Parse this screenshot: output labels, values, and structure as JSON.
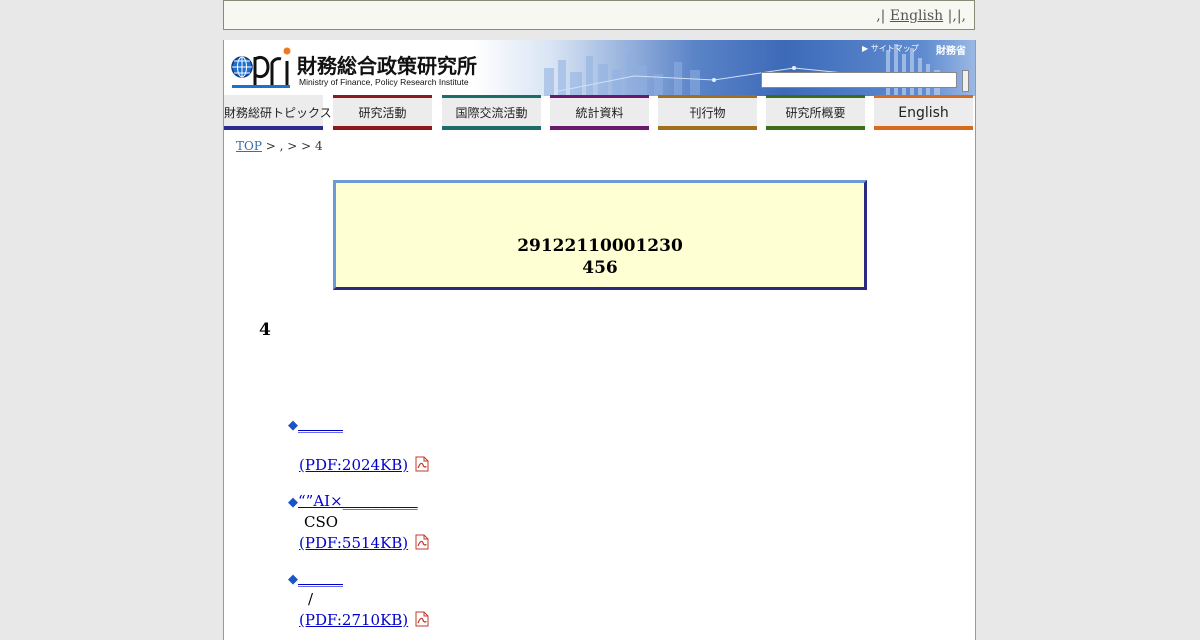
{
  "topbar": {
    "prefix": ",|",
    "english_link": "English",
    "suffix": "|,|,"
  },
  "header": {
    "logo_jp": "財務総合政策研究所",
    "logo_en": "Ministry of Finance, Policy Research Institute",
    "sitemap": "▶ サイトマップ",
    "mof": "財務省",
    "search": {
      "value": "",
      "placeholder": ""
    }
  },
  "nav": [
    {
      "label": "財務総研トピックス",
      "color_top": "#ececec",
      "color_bottom": "#2b2b8a"
    },
    {
      "label": "研究活動",
      "color_top": "#8b1a1a",
      "color_bottom": "#8b1a1a"
    },
    {
      "label": "国際交流活動",
      "color_top": "#1a6e6a",
      "color_bottom": "#1a6e6a"
    },
    {
      "label": "統計資料",
      "color_top": "#6a1a6e",
      "color_bottom": "#6a1a6e"
    },
    {
      "label": "刊行物",
      "color_top": "#a0701a",
      "color_bottom": "#a0701a"
    },
    {
      "label": "研究所概要",
      "color_top": "#3a6e1a",
      "color_bottom": "#3a6e1a"
    },
    {
      "label": "English",
      "color_top": "#d86a1a",
      "color_bottom": "#d86a1a"
    }
  ],
  "breadcrumb": {
    "top": "TOP",
    "rest": " > , > > 4"
  },
  "notice": {
    "line1": "29122110001230",
    "line2": "456"
  },
  "heading": "4",
  "items": [
    {
      "title": "______",
      "sub": "",
      "pdf": "(PDF:2024KB)"
    },
    {
      "title": "“”AI×__________",
      "sub": "CSO",
      "pdf": "(PDF:5514KB)"
    },
    {
      "title": "______",
      "sub": "/",
      "pdf": "(PDF:2710KB)"
    }
  ],
  "icons": {
    "bullet": "diamond-bullet-icon",
    "pdf": "pdf-icon"
  }
}
